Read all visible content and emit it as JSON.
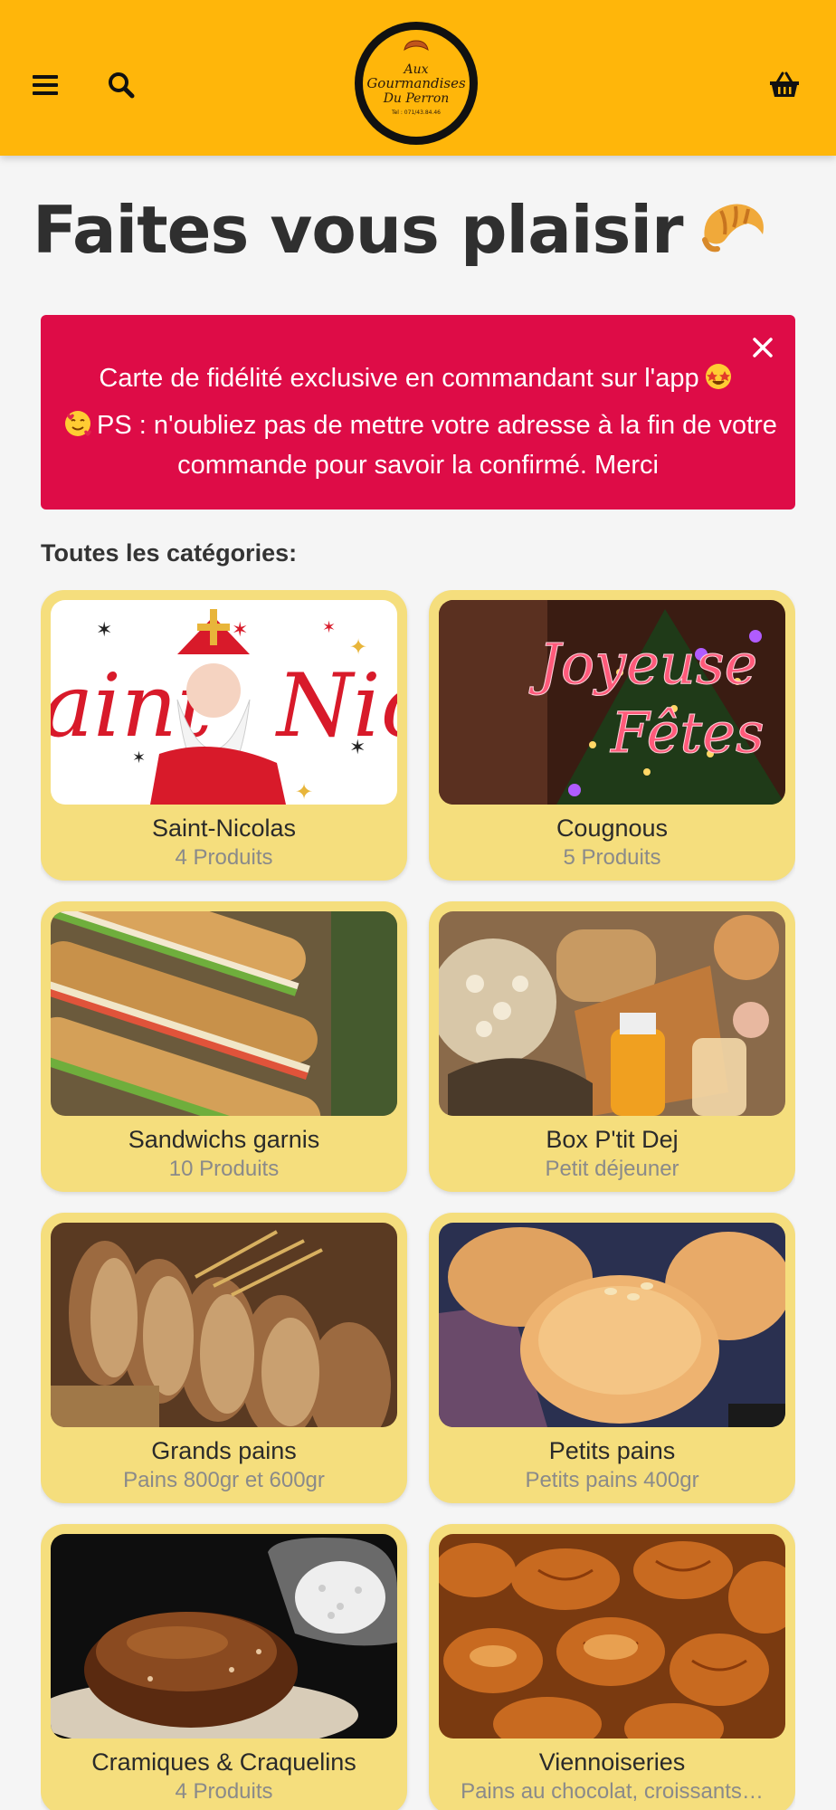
{
  "header": {
    "logo": {
      "line1": "Aux",
      "line2": "Gourmandises",
      "line3": "Du Perron",
      "phone": "Tel : 071/43.84.46"
    },
    "icons": {
      "menu": "menu-icon",
      "search": "search-icon",
      "cart": "basket-icon"
    }
  },
  "page": {
    "title": "Faites vous plaisir",
    "title_emoji": "croissant"
  },
  "alert": {
    "line1": "Carte de fidélité exclusive en commandant sur l'app",
    "line2": "PS : n'oubliez pas de mettre votre adresse à la fin de votre commande pour savoir la confirmé. Merci",
    "color": "#de0c47"
  },
  "categories": {
    "label": "Toutes les catégories:",
    "items": [
      {
        "name": "Saint-Nicolas",
        "sub": "4 Produits"
      },
      {
        "name": "Cougnous",
        "sub": "5 Produits"
      },
      {
        "name": "Sandwichs garnis",
        "sub": "10 Produits"
      },
      {
        "name": "Box P'tit Dej",
        "sub": "Petit déjeuner"
      },
      {
        "name": "Grands pains",
        "sub": "Pains 800gr et 600gr"
      },
      {
        "name": "Petits pains",
        "sub": "Petits pains 400gr"
      },
      {
        "name": "Cramiques & Craquelins",
        "sub": "4 Produits"
      },
      {
        "name": "Viennoiseries",
        "sub": "Pains au chocolat, croissants…"
      }
    ]
  },
  "colors": {
    "header": "#ffb60a",
    "card": "#f5de7d",
    "background": "#f5f5f5"
  }
}
